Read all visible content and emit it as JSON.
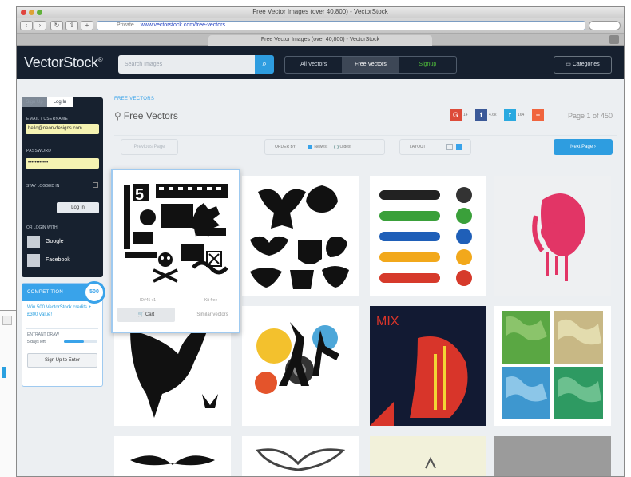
{
  "browser": {
    "window_title": "Free Vector Images (over 40,800) - VectorStock",
    "url_label": "Private",
    "url": "www.vectorstock.com/free-vectors",
    "tab_title": "Free Vector Images (over 40,800) - VectorStock"
  },
  "header": {
    "logo": "VectorStock",
    "logo_mark": "®",
    "search_placeholder": "Search Images",
    "nav": [
      "All Vectors",
      "Free Vectors",
      "Signup"
    ],
    "categories": "Categories"
  },
  "login": {
    "tabs": [
      "Sign Up",
      "Log In"
    ],
    "email_label": "EMAIL / USERNAME",
    "email_value": "hello@neon-designs.com",
    "password_label": "PASSWORD",
    "password_value": "••••••••••••",
    "stay_logged": "STAY LOGGED IN",
    "login_button": "Log In",
    "or_login_with": "OR LOGIN WITH",
    "google": "Google",
    "facebook": "Facebook"
  },
  "competition": {
    "heading": "COMPETITION",
    "badge": "500",
    "text": "Win 500 VectorStock credits + £300 value!",
    "subtitle": "ENTRANT DRAW",
    "days_left": "5 days left",
    "progress": 0.6,
    "button": "Sign Up to Enter"
  },
  "main": {
    "breadcrumb": "FREE VECTORS",
    "title": "Free Vectors",
    "share": {
      "google_count": "14",
      "facebook_count": "4.6k",
      "twitter_count": "164"
    },
    "page_info": "Page 1 of 450",
    "prev_page": "Previous Page",
    "order_by": "ORDER BY",
    "order_options": [
      "Newest",
      "Oldest"
    ],
    "layout": "LAYOUT",
    "next_page": "Next Page ›",
    "hover_card": {
      "meta_left": "ID#45 v1",
      "meta_right": "Kit-free",
      "cart": "Cart",
      "similar": "Similar vectors"
    }
  },
  "colors": {
    "nav_bg": "#16202f",
    "accent": "#2e9de0",
    "signup_green": "#4fbd3a"
  }
}
